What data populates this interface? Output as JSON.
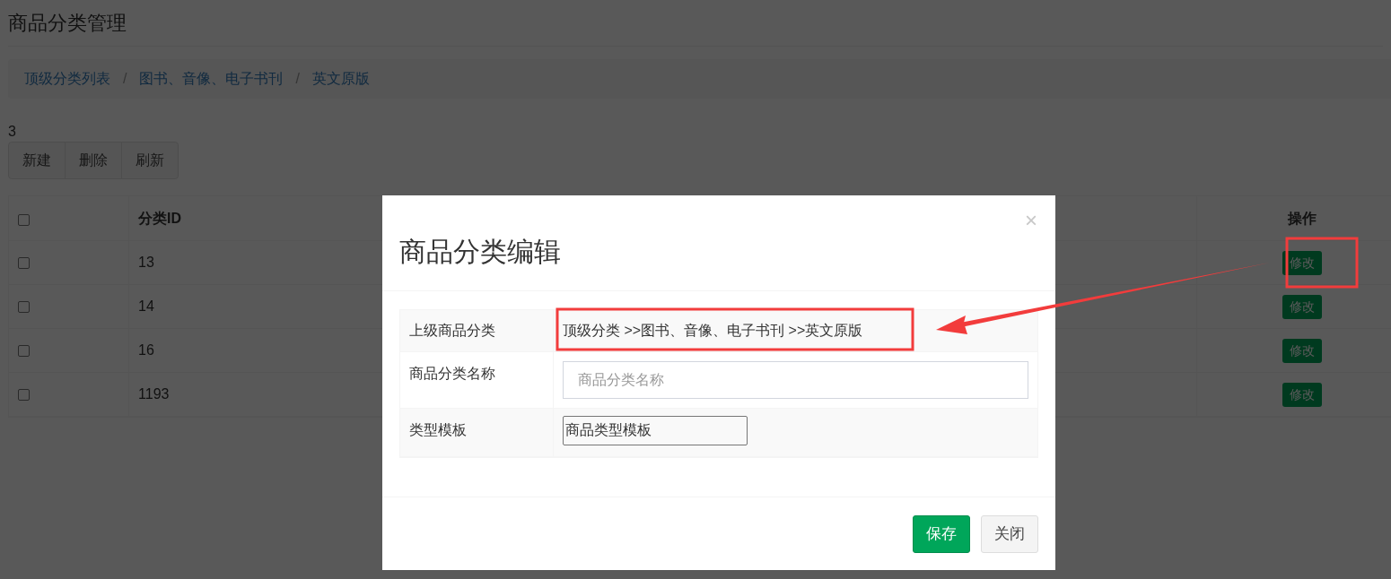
{
  "page": {
    "title": "商品分类管理"
  },
  "breadcrumb": [
    "顶级分类列表",
    "图书、音像、电子书刊",
    "英文原版"
  ],
  "breadcrumb_separators": [
    "/",
    "/"
  ],
  "count": "3",
  "toolbar": [
    "新建",
    "删除",
    "刷新"
  ],
  "table": {
    "header_checked": false,
    "columns": [
      "分类ID",
      "操作"
    ],
    "rows": [
      {
        "checked": false,
        "id": "13",
        "action": "修改"
      },
      {
        "checked": false,
        "id": "14",
        "action": "修改"
      },
      {
        "checked": false,
        "id": "16",
        "action": "修改"
      },
      {
        "checked": false,
        "id": "1193",
        "action": "修改"
      }
    ]
  },
  "dialog": {
    "title": "商品分类编辑",
    "close": "×",
    "fields": [
      {
        "kind": "text",
        "label": "上级商品分类",
        "value": "顶级分类 >>图书、音像、电子书刊 >>英文原版"
      },
      {
        "kind": "input",
        "label": "商品分类名称",
        "placeholder": "商品分类名称"
      },
      {
        "kind": "small_input",
        "label": "类型模板",
        "value": "商品类型模板"
      }
    ],
    "buttons": [
      {
        "kind": "primary",
        "label": "保存"
      },
      {
        "kind": "default",
        "label": "关闭"
      }
    ]
  }
}
